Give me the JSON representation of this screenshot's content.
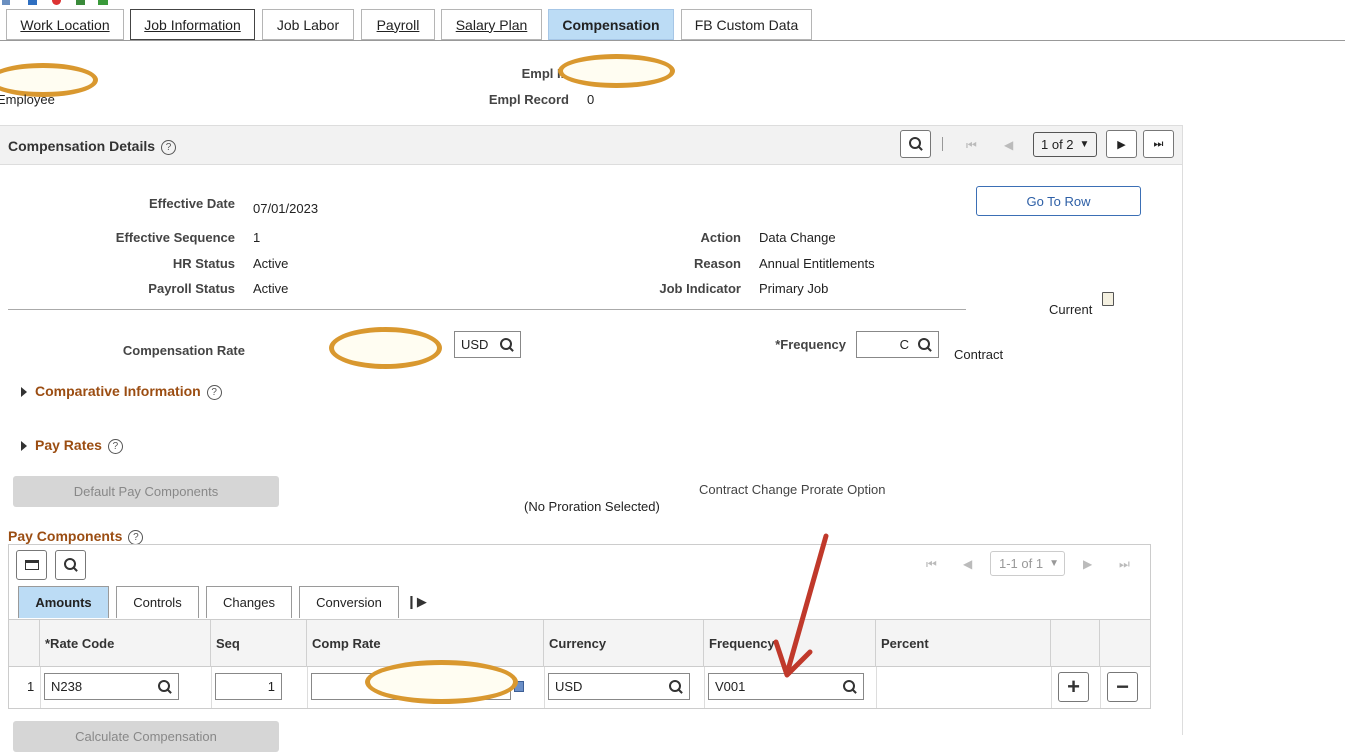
{
  "tabs": [
    {
      "label": "Work Location"
    },
    {
      "label": "Job Information"
    },
    {
      "label": "Job Labor"
    },
    {
      "label": "Payroll"
    },
    {
      "label": "Salary Plan"
    },
    {
      "label": "Compensation"
    },
    {
      "label": "FB Custom Data"
    }
  ],
  "header": {
    "employee_label": "Employee",
    "empl_id_label": "Empl ID",
    "empl_record_label": "Empl Record",
    "empl_record_value": "0"
  },
  "comp_details": {
    "title": "Compensation Details",
    "pager": "1 of 2",
    "go_to_row": "Go To Row",
    "effective_date_label": "Effective Date",
    "effective_date": "07/01/2023",
    "effective_sequence_label": "Effective Sequence",
    "effective_sequence": "1",
    "hr_status_label": "HR Status",
    "hr_status": "Active",
    "payroll_status_label": "Payroll Status",
    "payroll_status": "Active",
    "action_label": "Action",
    "action": "Data Change",
    "reason_label": "Reason",
    "reason": "Annual Entitlements",
    "job_indicator_label": "Job Indicator",
    "job_indicator": "Primary Job",
    "current_label": "Current",
    "comp_rate_label": "Compensation Rate",
    "currency": "USD",
    "frequency_label": "*Frequency",
    "frequency_code": "C",
    "frequency_desc": "Contract",
    "comparative_info": "Comparative Information",
    "pay_rates": "Pay Rates",
    "default_pay_components": "Default Pay Components",
    "contract_change_label": "Contract Change Prorate Option",
    "no_proration": "(No Proration Selected)"
  },
  "pay_components": {
    "title": "Pay Components",
    "pager": "1-1 of 1",
    "subtabs": [
      {
        "label": "Amounts"
      },
      {
        "label": "Controls"
      },
      {
        "label": "Changes"
      },
      {
        "label": "Conversion"
      }
    ],
    "columns": [
      "*Rate Code",
      "Seq",
      "Comp Rate",
      "Currency",
      "Frequency",
      "Percent"
    ],
    "rows": [
      {
        "num": "1",
        "rate_code": "N238",
        "seq": "1",
        "comp_rate": "",
        "currency": "USD",
        "frequency": "V001",
        "percent": ""
      }
    ],
    "calculate_btn": "Calculate Compensation"
  },
  "colors": {
    "accent": "#bcdcf5",
    "section_link": "#9b4d12",
    "annotation": "#d9982f",
    "arrow": "#c0392b"
  }
}
